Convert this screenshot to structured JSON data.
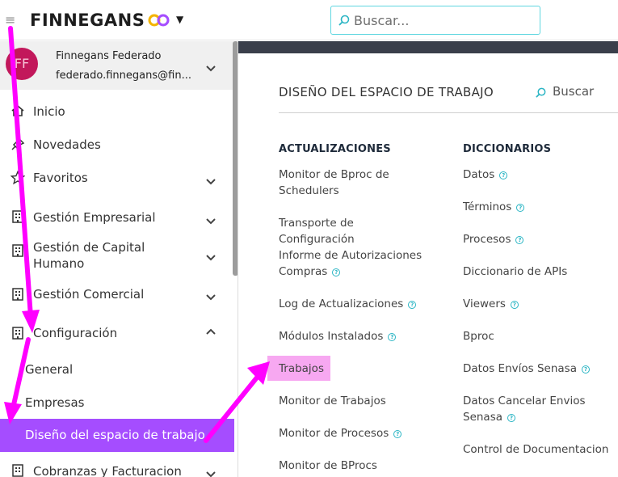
{
  "topbar": {
    "brand": "FINNEGANS",
    "search_placeholder": "Buscar..."
  },
  "profile": {
    "initials": "FF",
    "name": "Finnegans Federado",
    "email": "federado.finnegans@fin..."
  },
  "sidebar": {
    "items": [
      {
        "label": "Inicio",
        "icon": "home-icon"
      },
      {
        "label": "Novedades",
        "icon": "pin-icon"
      },
      {
        "label": "Favoritos",
        "icon": "star-icon"
      },
      {
        "label": "Gestión Empresarial",
        "icon": "building-icon"
      },
      {
        "label": "Gestión de Capital Humano",
        "icon": "building-icon"
      },
      {
        "label": "Gestión Comercial",
        "icon": "building-icon"
      },
      {
        "label": "Configuración",
        "icon": "building-icon"
      },
      {
        "label": "Cobranzas y Facturacion",
        "icon": "building-icon"
      }
    ],
    "sub_items": [
      "General",
      "Empresas",
      "Diseño del espacio de trabajo"
    ]
  },
  "content": {
    "title": "DISEÑO DEL ESPACIO DE TRABAJO",
    "search_label": "Buscar",
    "columns": [
      {
        "heading": "ACTUALIZACIONES",
        "links": [
          {
            "label": "Monitor de Bproc de Schedulers",
            "help": false
          },
          {
            "label": "Transporte de Configuración",
            "help": false
          },
          {
            "label": "Informe de Autorizaciones Compras",
            "help": true
          },
          {
            "label": "Log de Actualizaciones",
            "help": true
          },
          {
            "label": "Módulos Instalados",
            "help": true
          },
          {
            "label": "Trabajos",
            "help": false
          },
          {
            "label": "Monitor de Trabajos",
            "help": false
          },
          {
            "label": "Monitor de Procesos",
            "help": true
          },
          {
            "label": "Monitor de BProcs",
            "help": false
          }
        ]
      },
      {
        "heading": "DICCIONARIOS",
        "links": [
          {
            "label": "Datos",
            "help": true
          },
          {
            "label": "Términos",
            "help": true
          },
          {
            "label": "Procesos",
            "help": true
          },
          {
            "label": "Diccionario de APIs",
            "help": false
          },
          {
            "label": "Viewers",
            "help": true
          },
          {
            "label": "Bproc",
            "help": false
          },
          {
            "label": "Datos Envíos Senasa",
            "help": true
          },
          {
            "label": "Datos Cancelar Envios Senasa",
            "help": true
          },
          {
            "label": "Control de Documentacion",
            "help": false
          }
        ]
      }
    ]
  },
  "colors": {
    "accent": "#a54dff",
    "highlight": "#f7a8f1",
    "annotation": "#ff00ff",
    "search_border": "#5fd6e0",
    "avatar": "#c2185b"
  }
}
